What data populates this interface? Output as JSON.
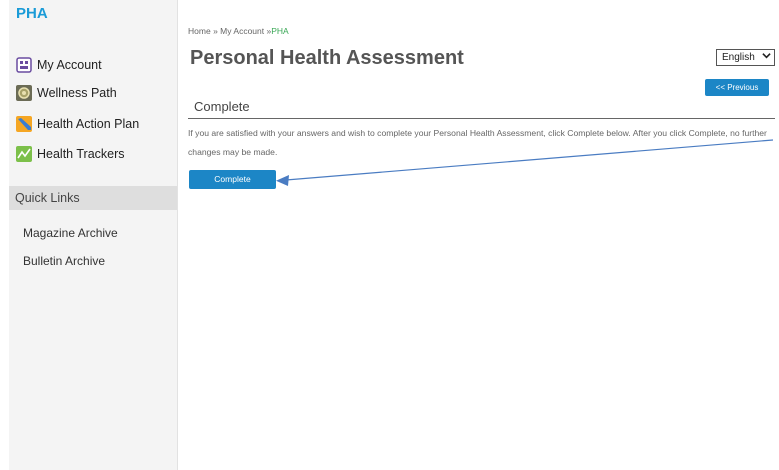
{
  "sidebar": {
    "title": "PHA",
    "items": [
      {
        "label": "My Account",
        "icon": "my-account-icon"
      },
      {
        "label": "Wellness Path",
        "icon": "wellness-path-icon"
      },
      {
        "label": "Health Action Plan",
        "icon": "health-action-plan-icon"
      },
      {
        "label": "Health Trackers",
        "icon": "health-trackers-icon"
      }
    ],
    "quick_links_header": "Quick Links",
    "quick_links": [
      "Magazine Archive",
      "Bulletin Archive"
    ]
  },
  "breadcrumb": {
    "home": "Home",
    "sep1": "»",
    "account": "My Account",
    "sep2": "»",
    "current": "PHA"
  },
  "main": {
    "title": "Personal Health Assessment",
    "language": "English",
    "previous_label": "<< Previous",
    "section_title": "Complete",
    "body_text": "If you are satisfied with your answers and wish to complete your Personal Health Assessment, click Complete below. After you click Complete, no further changes may be made.",
    "complete_label": "Complete"
  },
  "colors": {
    "accent_blue": "#1c86c6",
    "title_blue": "#1a9bd7",
    "breadcrumb_green": "#3aa856"
  }
}
